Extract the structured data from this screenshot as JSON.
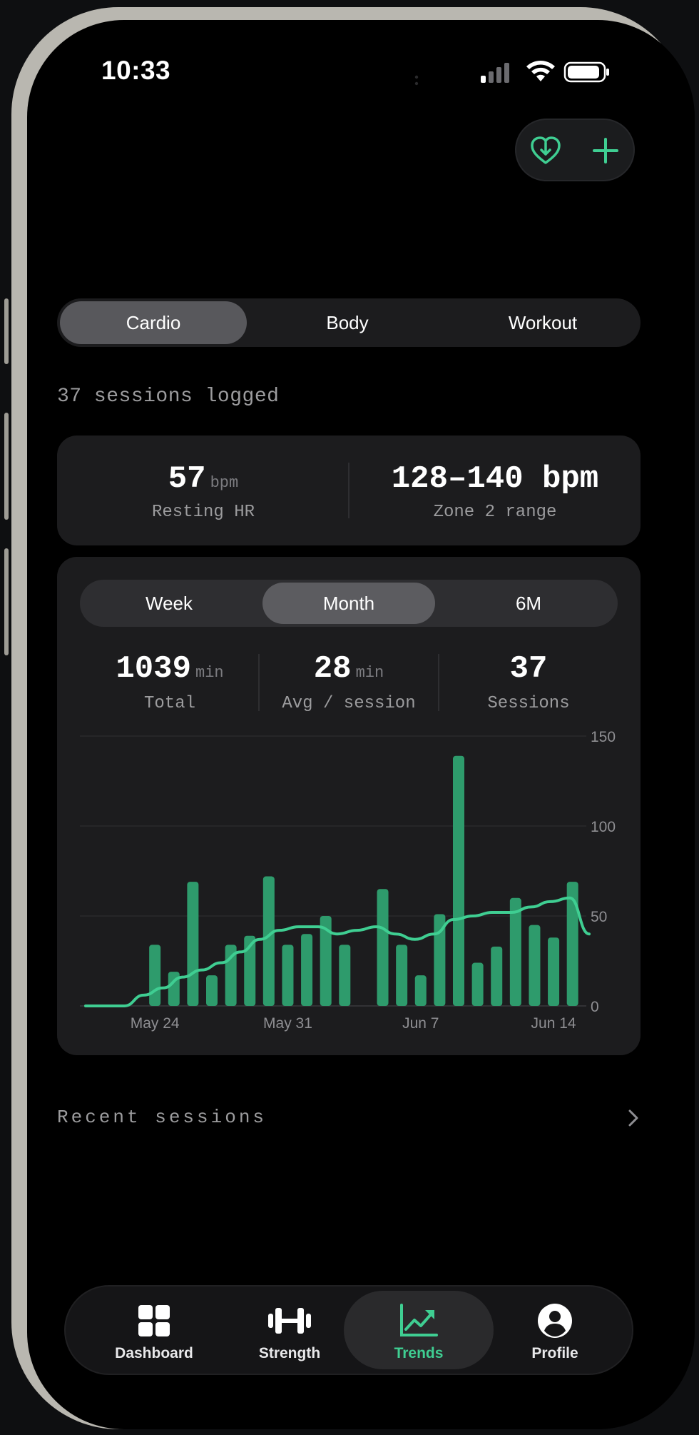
{
  "status_bar": {
    "time": "10:33"
  },
  "top_actions": {
    "health_import_icon": "heart-download-icon",
    "add_icon": "plus-icon"
  },
  "category_tabs": [
    {
      "label": "Cardio",
      "active": true
    },
    {
      "label": "Body",
      "active": false
    },
    {
      "label": "Workout",
      "active": false
    }
  ],
  "sessions_logged": "37 sessions logged",
  "heart_stats": {
    "resting_value": "57",
    "resting_unit": "bpm",
    "resting_label": "Resting HR",
    "zone_value": "128–140 bpm",
    "zone_label": "Zone 2 range"
  },
  "range_tabs": [
    {
      "label": "Week",
      "active": false
    },
    {
      "label": "Month",
      "active": true
    },
    {
      "label": "6M",
      "active": false
    }
  ],
  "summary": {
    "total_value": "1039",
    "total_unit": "min",
    "total_label": "Total",
    "avg_value": "28",
    "avg_unit": "min",
    "avg_label": "Avg / session",
    "sessions_value": "37",
    "sessions_label": "Sessions"
  },
  "chart_data": {
    "type": "bar",
    "overlay": "line (smoothed average)",
    "ylim": [
      0,
      150
    ],
    "yticks": [
      0,
      50,
      100,
      150
    ],
    "y_axis_side": "right",
    "grid": true,
    "xtick_labels": [
      "May 24",
      "May 31",
      "Jun 7",
      "Jun 14"
    ],
    "bar_color": "#2e9b6c",
    "line_color": "#3fce92",
    "bars": [
      {
        "date": "May 21",
        "value": 0
      },
      {
        "date": "May 22",
        "value": 0
      },
      {
        "date": "May 23",
        "value": 0
      },
      {
        "date": "May 24",
        "value": 34
      },
      {
        "date": "May 25",
        "value": 19
      },
      {
        "date": "May 26",
        "value": 69
      },
      {
        "date": "May 27",
        "value": 17
      },
      {
        "date": "May 28",
        "value": 34
      },
      {
        "date": "May 29",
        "value": 39
      },
      {
        "date": "May 30",
        "value": 72
      },
      {
        "date": "May 31",
        "value": 34
      },
      {
        "date": "Jun 1",
        "value": 40
      },
      {
        "date": "Jun 2",
        "value": 50
      },
      {
        "date": "Jun 3",
        "value": 34
      },
      {
        "date": "Jun 4",
        "value": 0
      },
      {
        "date": "Jun 5",
        "value": 65
      },
      {
        "date": "Jun 6",
        "value": 34
      },
      {
        "date": "Jun 7",
        "value": 17
      },
      {
        "date": "Jun 8",
        "value": 51
      },
      {
        "date": "Jun 9",
        "value": 139
      },
      {
        "date": "Jun 10",
        "value": 24
      },
      {
        "date": "Jun 11",
        "value": 33
      },
      {
        "date": "Jun 12",
        "value": 60
      },
      {
        "date": "Jun 13",
        "value": 45
      },
      {
        "date": "Jun 14",
        "value": 38
      },
      {
        "date": "Jun 15",
        "value": 69
      }
    ],
    "line": [
      0,
      0,
      0,
      6,
      10,
      16,
      20,
      24,
      30,
      37,
      42,
      44,
      44,
      40,
      42,
      44,
      40,
      37,
      40,
      48,
      50,
      52,
      52,
      55,
      58,
      60,
      40
    ]
  },
  "recent": {
    "label": "Recent sessions"
  },
  "tab_bar": [
    {
      "label": "Dashboard",
      "icon": "grid-icon",
      "active": false
    },
    {
      "label": "Strength",
      "icon": "dumbbell-icon",
      "active": false
    },
    {
      "label": "Trends",
      "icon": "trend-chart-icon",
      "active": true
    },
    {
      "label": "Profile",
      "icon": "profile-icon",
      "active": false
    }
  ]
}
